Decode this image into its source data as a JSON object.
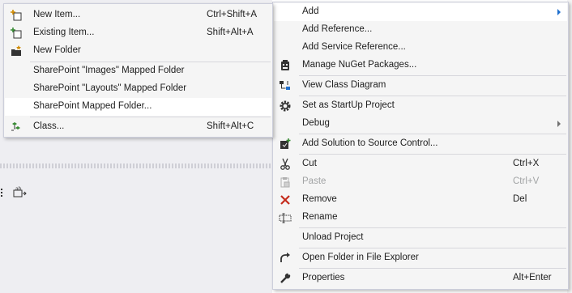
{
  "submenu": {
    "items": [
      {
        "label": "New Item...",
        "shortcut": "Ctrl+Shift+A",
        "icon": "new-item-icon"
      },
      {
        "label": "Existing Item...",
        "shortcut": "Shift+Alt+A",
        "icon": "existing-item-icon"
      },
      {
        "label": "New Folder",
        "shortcut": "",
        "icon": "new-folder-icon"
      },
      {
        "label": "SharePoint \"Images\" Mapped Folder",
        "shortcut": ""
      },
      {
        "label": "SharePoint \"Layouts\" Mapped Folder",
        "shortcut": ""
      },
      {
        "label": "SharePoint Mapped Folder...",
        "shortcut": ""
      },
      {
        "label": "Class...",
        "shortcut": "Shift+Alt+C",
        "icon": "class-icon"
      }
    ]
  },
  "mainmenu": {
    "items": [
      {
        "label": "Add",
        "shortcut": ""
      },
      {
        "label": "Add Reference...",
        "shortcut": ""
      },
      {
        "label": "Add Service Reference...",
        "shortcut": ""
      },
      {
        "label": "Manage NuGet Packages...",
        "shortcut": "",
        "icon": "nuget-icon"
      },
      {
        "label": "View Class Diagram",
        "shortcut": "",
        "icon": "class-diagram-icon"
      },
      {
        "label": "Set as StartUp Project",
        "shortcut": "",
        "icon": "gear-icon"
      },
      {
        "label": "Debug",
        "shortcut": ""
      },
      {
        "label": "Add Solution to Source Control...",
        "shortcut": "",
        "icon": "source-control-icon"
      },
      {
        "label": "Cut",
        "shortcut": "Ctrl+X",
        "icon": "scissors-icon"
      },
      {
        "label": "Paste",
        "shortcut": "Ctrl+V",
        "icon": "paste-icon"
      },
      {
        "label": "Remove",
        "shortcut": "Del",
        "icon": "remove-icon"
      },
      {
        "label": "Rename",
        "shortcut": "",
        "icon": "rename-icon"
      },
      {
        "label": "Unload Project",
        "shortcut": ""
      },
      {
        "label": "Open Folder in File Explorer",
        "shortcut": "",
        "icon": "open-folder-icon"
      },
      {
        "label": "Properties",
        "shortcut": "Alt+Enter",
        "icon": "wrench-icon"
      }
    ]
  },
  "colors": {
    "menu_bg": "#f5f5f5",
    "highlight": "#ffffff",
    "disabled": "#a2a4a5",
    "accent": "#1e6fce"
  }
}
